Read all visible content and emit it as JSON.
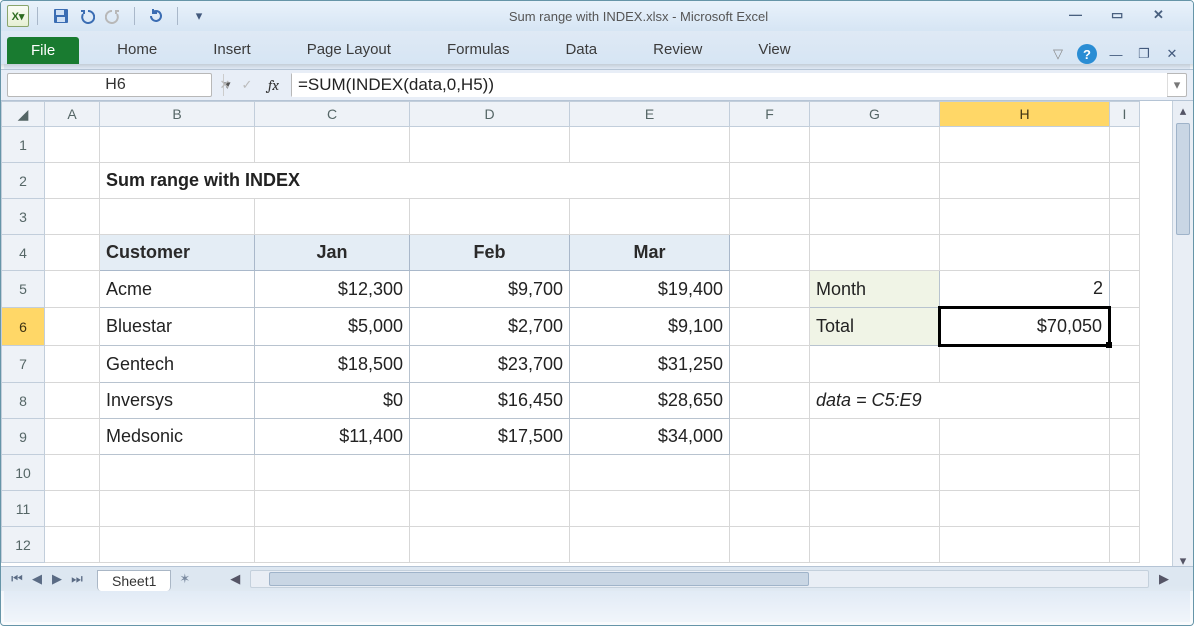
{
  "title": "Sum range with INDEX.xlsx  -  Microsoft Excel",
  "ribbon": {
    "file": "File",
    "tabs": [
      "Home",
      "Insert",
      "Page Layout",
      "Formulas",
      "Data",
      "Review",
      "View"
    ]
  },
  "namebox": "H6",
  "formula": "=SUM(INDEX(data,0,H5))",
  "columns": [
    "A",
    "B",
    "C",
    "D",
    "E",
    "F",
    "G",
    "H",
    "I"
  ],
  "rows": [
    "1",
    "2",
    "3",
    "4",
    "5",
    "6",
    "7",
    "8",
    "9",
    "10",
    "11",
    "12"
  ],
  "selected": {
    "col": "H",
    "row": "6"
  },
  "heading": "Sum range with INDEX",
  "table": {
    "headers": [
      "Customer",
      "Jan",
      "Feb",
      "Mar"
    ],
    "rows": [
      [
        "Acme",
        "$12,300",
        "$9,700",
        "$19,400"
      ],
      [
        "Bluestar",
        "$5,000",
        "$2,700",
        "$9,100"
      ],
      [
        "Gentech",
        "$18,500",
        "$23,700",
        "$31,250"
      ],
      [
        "Inversys",
        "$0",
        "$16,450",
        "$28,650"
      ],
      [
        "Medsonic",
        "$11,400",
        "$17,500",
        "$34,000"
      ]
    ]
  },
  "side": {
    "month_label": "Month",
    "month_val": "2",
    "total_label": "Total",
    "total_val": "$70,050"
  },
  "note": "data = C5:E9",
  "sheet_tab": "Sheet1"
}
